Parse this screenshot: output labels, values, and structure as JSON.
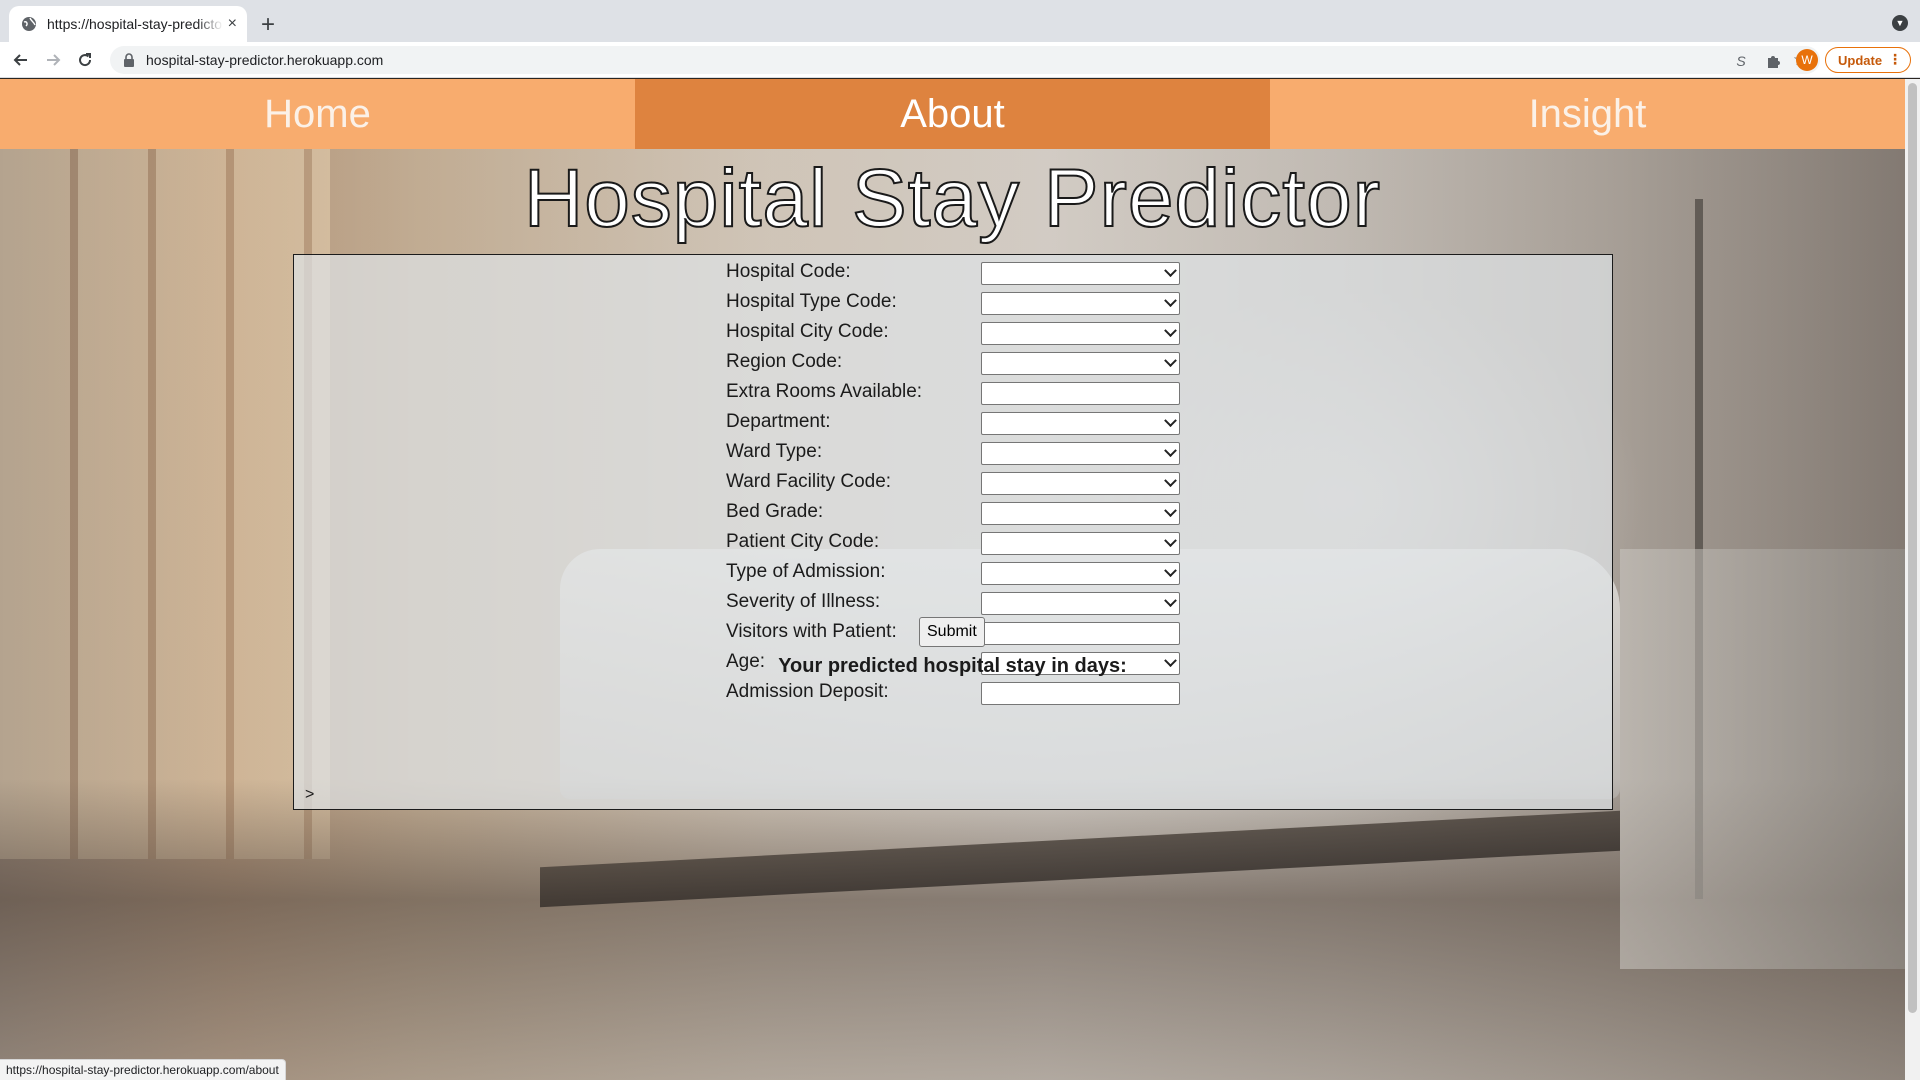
{
  "browser": {
    "tab_title": "https://hospital-stay-predictor.herokuapp.com",
    "tab_close": "×",
    "new_tab": "+",
    "url": "hospital-stay-predictor.herokuapp.com",
    "update_label": "Update",
    "profile_initial": "W",
    "status_url": "https://hospital-stay-predictor.herokuapp.com/about"
  },
  "nav": {
    "home": "Home",
    "about": "About",
    "insight": "Insight",
    "active": "about"
  },
  "page": {
    "title": "Hospital Stay Predictor"
  },
  "form": {
    "fields": [
      {
        "label": "Hospital Code:",
        "control": "select",
        "value": ""
      },
      {
        "label": "Hospital Type Code:",
        "control": "select",
        "value": ""
      },
      {
        "label": "Hospital City Code:",
        "control": "select",
        "value": ""
      },
      {
        "label": "Region Code:",
        "control": "select",
        "value": ""
      },
      {
        "label": "Extra Rooms Available:",
        "control": "text",
        "value": ""
      },
      {
        "label": "Department:",
        "control": "select",
        "value": ""
      },
      {
        "label": "Ward Type:",
        "control": "select",
        "value": ""
      },
      {
        "label": "Ward Facility Code:",
        "control": "select",
        "value": ""
      },
      {
        "label": "Bed Grade:",
        "control": "select",
        "value": ""
      },
      {
        "label": "Patient City Code:",
        "control": "select",
        "value": ""
      },
      {
        "label": "Type of Admission:",
        "control": "select",
        "value": ""
      },
      {
        "label": "Severity of Illness:",
        "control": "select",
        "value": ""
      },
      {
        "label": "Visitors with Patient:",
        "control": "text",
        "value": ""
      },
      {
        "label": "Age:",
        "control": "select",
        "value": ""
      },
      {
        "label": "Admission Deposit:",
        "control": "text",
        "value": ""
      }
    ],
    "submit_label": "Submit",
    "result_label": "Your predicted hospital stay in days:",
    "result_caret": ">"
  },
  "colors": {
    "nav_bg": "#f8ac6e",
    "nav_active_bg": "#de833f",
    "accent": "#e8710a"
  }
}
